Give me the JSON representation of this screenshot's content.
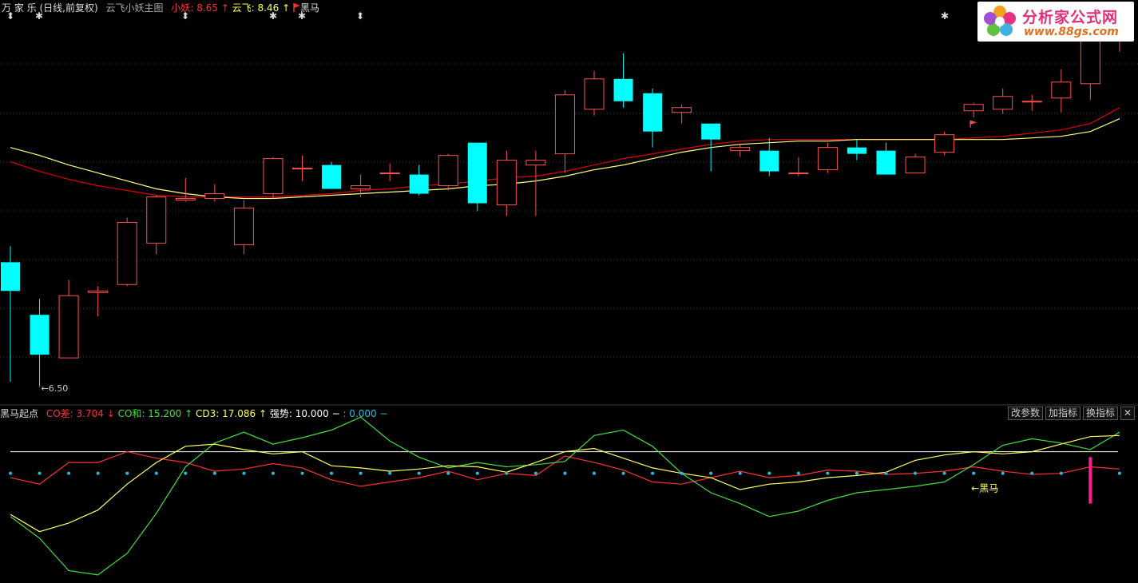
{
  "header": {
    "stock_name": "万 家 乐",
    "period": "(日线,前复权)",
    "template_name": "云飞小妖主图",
    "xiaoyao_label": "小妖",
    "xiaoyao_value": ": 8.65",
    "xiaoyao_arrow": "↑",
    "yunfei_label": "云飞",
    "yunfei_value": ": 8.46",
    "yunfei_arrow": "↑",
    "heima_flag_label": "黑马"
  },
  "top_markers": [
    "⬍",
    "✱",
    "⬍",
    "✱",
    "✱",
    "⬍",
    "✱"
  ],
  "logo": {
    "title": "分析家公式网",
    "url": "www.88gs.com"
  },
  "indicator_header": {
    "name": "黑马起点",
    "co_diff_label": "CO差",
    "co_diff_value": ": 3.704",
    "co_diff_arrow": "↓",
    "co_sum_label": "CO和",
    "co_sum_value": ": 15.200",
    "co_sum_arrow": "↑",
    "cd3_label": "CD3",
    "cd3_value": ": 17.086",
    "cd3_arrow": "↑",
    "strength_label": "强势",
    "strength_value": ": 10.000",
    "strength_dash": "−",
    "extra_value": ": 0.000",
    "extra_dash": "−"
  },
  "buttons": {
    "params": "改参数",
    "add_indicator": "加指标",
    "switch_indicator": "换指标",
    "close": "✕"
  },
  "colors": {
    "up": "#ff5050",
    "down": "#00ffff",
    "ma_red": "#e00000",
    "ma_yellow": "#ffff80",
    "co_diff": "#ff3030",
    "co_sum": "#40e040",
    "cd3": "#ffff60",
    "white_line": "#ffffff",
    "dots": "#20c0e0",
    "pink_bar": "#ff2090"
  },
  "chart_data": [
    {
      "type": "candlestick",
      "title": "云飞小妖主图",
      "low_annotation": "6.50",
      "signal_label": "黑马",
      "ylim": [
        6.42,
        8.85
      ],
      "candles": [
        {
          "o": 7.28,
          "h": 7.38,
          "l": 6.53,
          "c": 7.1
        },
        {
          "o": 6.95,
          "h": 7.05,
          "l": 6.5,
          "c": 6.7
        },
        {
          "o": 6.68,
          "h": 7.17,
          "l": 6.68,
          "c": 7.07
        },
        {
          "o": 7.09,
          "h": 7.13,
          "l": 6.94,
          "c": 7.1
        },
        {
          "o": 7.14,
          "h": 7.56,
          "l": 7.13,
          "c": 7.53
        },
        {
          "o": 7.4,
          "h": 7.7,
          "l": 7.33,
          "c": 7.69
        },
        {
          "o": 7.67,
          "h": 7.81,
          "l": 7.66,
          "c": 7.68
        },
        {
          "o": 7.68,
          "h": 7.77,
          "l": 7.66,
          "c": 7.71
        },
        {
          "o": 7.39,
          "h": 7.67,
          "l": 7.33,
          "c": 7.62
        },
        {
          "o": 7.71,
          "h": 7.94,
          "l": 7.68,
          "c": 7.93
        },
        {
          "o": 7.87,
          "h": 7.95,
          "l": 7.79,
          "c": 7.87
        },
        {
          "o": 7.89,
          "h": 7.91,
          "l": 7.76,
          "c": 7.74
        },
        {
          "o": 7.74,
          "h": 7.83,
          "l": 7.69,
          "c": 7.76
        },
        {
          "o": 7.84,
          "h": 7.9,
          "l": 7.79,
          "c": 7.84
        },
        {
          "o": 7.83,
          "h": 7.89,
          "l": 7.7,
          "c": 7.71
        },
        {
          "o": 7.76,
          "h": 7.96,
          "l": 7.73,
          "c": 7.95
        },
        {
          "o": 8.03,
          "h": 8.03,
          "l": 7.6,
          "c": 7.65
        },
        {
          "o": 7.64,
          "h": 7.98,
          "l": 7.57,
          "c": 7.92
        },
        {
          "o": 7.89,
          "h": 7.98,
          "l": 7.57,
          "c": 7.92
        },
        {
          "o": 7.96,
          "h": 8.36,
          "l": 7.84,
          "c": 8.33
        },
        {
          "o": 8.24,
          "h": 8.48,
          "l": 8.2,
          "c": 8.43
        },
        {
          "o": 8.43,
          "h": 8.59,
          "l": 8.25,
          "c": 8.29
        },
        {
          "o": 8.34,
          "h": 8.37,
          "l": 8.0,
          "c": 8.1
        },
        {
          "o": 8.22,
          "h": 8.27,
          "l": 8.15,
          "c": 8.25
        },
        {
          "o": 8.15,
          "h": 8.15,
          "l": 7.85,
          "c": 8.05
        },
        {
          "o": 7.98,
          "h": 8.02,
          "l": 7.94,
          "c": 8.0
        },
        {
          "o": 7.98,
          "h": 8.06,
          "l": 7.82,
          "c": 7.85
        },
        {
          "o": 7.84,
          "h": 7.94,
          "l": 7.82,
          "c": 7.84
        },
        {
          "o": 7.86,
          "h": 8.03,
          "l": 7.84,
          "c": 8.0
        },
        {
          "o": 8.0,
          "h": 8.05,
          "l": 7.92,
          "c": 7.96
        },
        {
          "o": 7.98,
          "h": 8.03,
          "l": 7.88,
          "c": 7.83
        },
        {
          "o": 7.84,
          "h": 7.96,
          "l": 7.84,
          "c": 7.94
        },
        {
          "o": 7.97,
          "h": 8.1,
          "l": 7.95,
          "c": 8.08
        },
        {
          "o": 8.23,
          "h": 8.28,
          "l": 8.19,
          "c": 8.27
        },
        {
          "o": 8.24,
          "h": 8.37,
          "l": 8.21,
          "c": 8.32
        },
        {
          "o": 8.29,
          "h": 8.33,
          "l": 8.23,
          "c": 8.29
        },
        {
          "o": 8.31,
          "h": 8.49,
          "l": 8.22,
          "c": 8.41
        },
        {
          "o": 8.4,
          "h": 8.64,
          "l": 8.3,
          "c": 8.71
        },
        {
          "o": 8.73,
          "h": 8.85,
          "l": 8.6,
          "c": 8.79
        }
      ],
      "ma_red": [
        7.91,
        7.85,
        7.8,
        7.76,
        7.73,
        7.7,
        7.69,
        7.69,
        7.69,
        7.69,
        7.7,
        7.71,
        7.73,
        7.74,
        7.76,
        7.77,
        7.79,
        7.81,
        7.82,
        7.85,
        7.89,
        7.93,
        7.96,
        7.99,
        8.02,
        8.04,
        8.05,
        8.05,
        8.05,
        8.05,
        8.05,
        8.05,
        8.05,
        8.06,
        8.07,
        8.09,
        8.11,
        8.15,
        8.25
      ],
      "ma_yellow": [
        8.0,
        7.95,
        7.89,
        7.84,
        7.79,
        7.74,
        7.71,
        7.69,
        7.68,
        7.68,
        7.69,
        7.7,
        7.71,
        7.72,
        7.73,
        7.74,
        7.76,
        7.77,
        7.79,
        7.82,
        7.86,
        7.89,
        7.93,
        7.97,
        8.0,
        8.02,
        8.03,
        8.04,
        8.04,
        8.05,
        8.05,
        8.05,
        8.05,
        8.05,
        8.05,
        8.06,
        8.07,
        8.1,
        8.18
      ]
    },
    {
      "type": "line",
      "title": "黑马起点",
      "ylim": [
        -2,
        13
      ],
      "reference_line": 10,
      "dot_level": 8,
      "series": [
        {
          "name": "CO差",
          "values": [
            7.6,
            7.0,
            9.0,
            9.0,
            10.0,
            9.4,
            9.0,
            8.2,
            8.4,
            8.9,
            8.5,
            7.4,
            6.8,
            7.2,
            7.6,
            8.2,
            7.4,
            8.0,
            7.8,
            9.6,
            9.0,
            8.3,
            7.2,
            7.0,
            7.6,
            8.2,
            7.6,
            7.8,
            8.3,
            8.2,
            7.9,
            8.0,
            8.2,
            8.6,
            8.2,
            7.9,
            8.0,
            8.6,
            8.4
          ]
        },
        {
          "name": "CO和",
          "values": [
            4.0,
            2.0,
            -1.0,
            -1.4,
            0.6,
            4.3,
            8.6,
            10.8,
            11.8,
            10.7,
            11.3,
            12.0,
            13.2,
            11.0,
            9.5,
            8.5,
            9.0,
            8.6,
            8.8,
            9.1,
            11.5,
            12.0,
            10.5,
            8.0,
            6.2,
            5.2,
            4.0,
            4.5,
            5.5,
            6.2,
            6.5,
            6.8,
            7.2,
            8.8,
            10.6,
            11.2,
            10.8,
            10.2,
            11.8
          ]
        },
        {
          "name": "CD3",
          "values": [
            4.2,
            2.6,
            3.4,
            4.6,
            7.0,
            9.0,
            10.5,
            10.7,
            10.2,
            9.8,
            10.0,
            8.7,
            8.5,
            8.2,
            8.4,
            8.7,
            8.6,
            8.1,
            9.0,
            10.0,
            10.3,
            9.4,
            8.5,
            8.0,
            7.6,
            6.5,
            7.0,
            7.2,
            7.6,
            7.8,
            8.1,
            9.2,
            9.7,
            10.0,
            9.8,
            10.0,
            10.7,
            11.4,
            11.5
          ]
        }
      ]
    }
  ]
}
